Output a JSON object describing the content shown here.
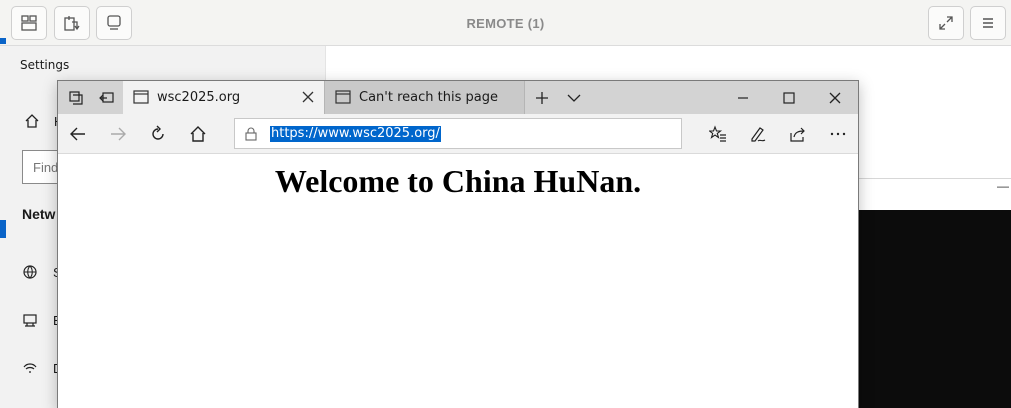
{
  "viewer": {
    "title": "REMOTE (1)",
    "buttons": {
      "layout": "layout-icon",
      "clipboard": "clipboard-icon",
      "display": "display-icon",
      "fullscreen": "fullscreen-icon",
      "menu": "menu-icon"
    }
  },
  "settings": {
    "title": "Settings",
    "home": "H",
    "search_placeholder": "Find",
    "section": "Netw",
    "items": [
      {
        "icon": "globe-icon",
        "label": "S"
      },
      {
        "icon": "ethernet-icon",
        "label": "E"
      },
      {
        "icon": "dialup-icon",
        "label": "D"
      }
    ]
  },
  "browser": {
    "tabs": [
      {
        "label": "wsc2025.org",
        "active": true
      },
      {
        "label": "Can't reach this page",
        "active": false
      }
    ],
    "address": "https://www.wsc2025.org/",
    "page_heading": "Welcome to China HuNan."
  },
  "colors": {
    "accent": "#0066cc",
    "tabstrip": "#d3d3d3",
    "console": "#0c0c0c"
  }
}
